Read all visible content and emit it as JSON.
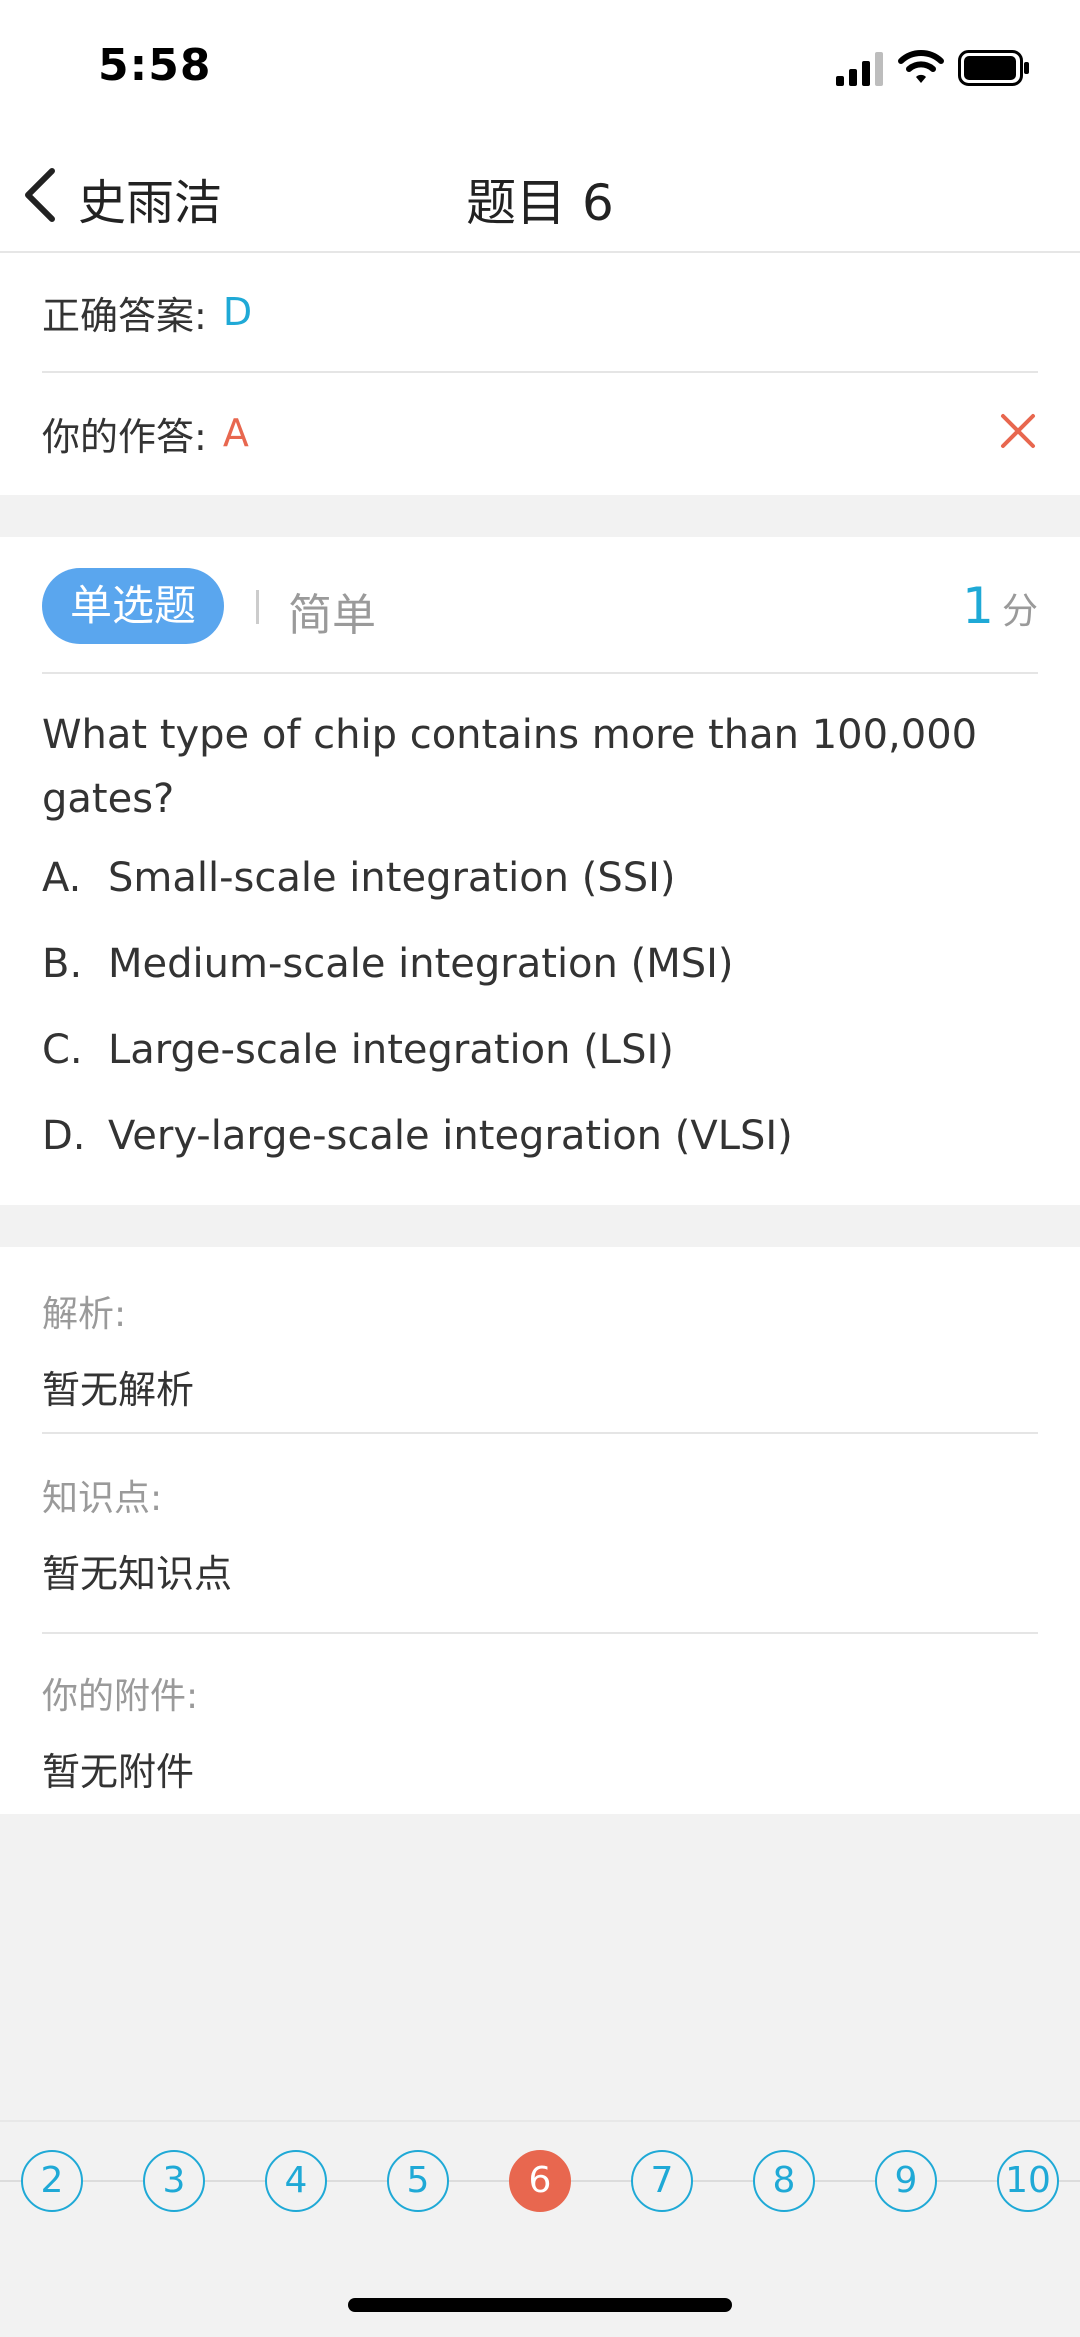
{
  "status_bar": {
    "time": "5:58",
    "icons": [
      "signal-icon",
      "wifi-icon",
      "battery-icon"
    ]
  },
  "nav": {
    "back_label": "史雨洁",
    "title": "题目 6",
    "back_icon": "chevron-left-icon"
  },
  "answers": {
    "correct_label": "正确答案:",
    "correct_value": "D",
    "yours_label": "你的作答:",
    "yours_value": "A",
    "result_icon": "close-icon"
  },
  "question": {
    "type": "单选题",
    "difficulty": "简单",
    "score_value": "1",
    "score_unit": "分",
    "text": "What type of chip contains more than 100,000 gates?",
    "options": [
      {
        "letter": "A.",
        "text": "Small-scale integration (SSI)"
      },
      {
        "letter": "B.",
        "text": "Medium-scale integration (MSI)"
      },
      {
        "letter": "C.",
        "text": "Large-scale integration (LSI)"
      },
      {
        "letter": "D.",
        "text": "Very-large-scale integration (VLSI)"
      }
    ]
  },
  "analysis": {
    "analysis_label": "解析:",
    "analysis_value": "暂无解析",
    "knowledge_label": "知识点:",
    "knowledge_value": "暂无知识点",
    "attachment_label": "你的附件:",
    "attachment_value": "暂无附件"
  },
  "pager": {
    "pages": [
      "2",
      "3",
      "4",
      "5",
      "6",
      "7",
      "8",
      "9",
      "10"
    ],
    "current": "6"
  },
  "colors": {
    "accent": "#1fa9d6",
    "wrong": "#e8674f",
    "badge": "#5aa6ee"
  }
}
